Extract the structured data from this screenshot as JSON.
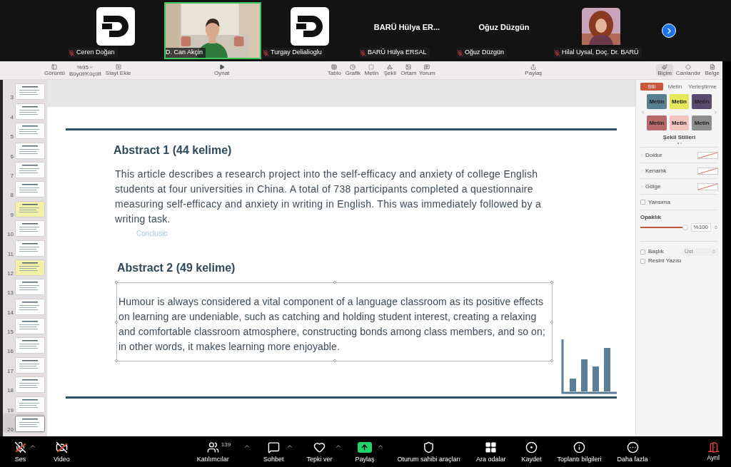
{
  "participants": [
    {
      "name": "Ceren Doğan",
      "kind": "logo",
      "muted": true,
      "active": false
    },
    {
      "name": "D. Can Akçin",
      "kind": "video",
      "muted": false,
      "active": true
    },
    {
      "name": "Turgay Delialioglu",
      "kind": "logo",
      "muted": true,
      "active": false
    },
    {
      "name": "BARÜ Hülya ERSAL",
      "kind": "name",
      "display": "BARÜ Hülya ER...",
      "muted": true,
      "active": false
    },
    {
      "name": "Oğuz Düzgün",
      "kind": "name",
      "display": "Oğuz Düzgün",
      "muted": true,
      "active": false
    },
    {
      "name": "Hilal Uysal, Doç. Dr. BARÜ",
      "muted": true,
      "active": false
    }
  ],
  "toolbar": {
    "left": [
      {
        "label": "Görüntü",
        "kind": "icon"
      },
      {
        "label": "Büyüt/Küçült",
        "kind": "zoom",
        "value": "%95"
      },
      {
        "label": "Slayt Ekle",
        "kind": "icon"
      }
    ],
    "center": {
      "label": "Oynat"
    },
    "insert": [
      "Tablo",
      "Grafik",
      "Metin",
      "Şekil",
      "Ortam",
      "Yorum"
    ],
    "share": "Paylaş",
    "right": [
      {
        "label": "Biçim",
        "selected": true
      },
      {
        "label": "Canlandır",
        "selected": false
      },
      {
        "label": "Belge",
        "selected": false
      }
    ]
  },
  "slides": [
    {
      "number": "3",
      "color": "#ffffff",
      "selected": false
    },
    {
      "number": "4",
      "color": "#ffffff",
      "selected": false
    },
    {
      "number": "5",
      "color": "#ffffff",
      "selected": false
    },
    {
      "number": "6",
      "color": "#ffffff",
      "selected": false
    },
    {
      "number": "7",
      "color": "#ffffff",
      "selected": false
    },
    {
      "number": "8",
      "color": "#ffffff",
      "selected": false
    },
    {
      "number": "9",
      "color": "#f3f0a8",
      "selected": false
    },
    {
      "number": "10",
      "color": "#ffffff",
      "selected": false
    },
    {
      "number": "11",
      "color": "#ffffff",
      "selected": false
    },
    {
      "number": "12",
      "color": "#f3f0a8",
      "selected": false
    },
    {
      "number": "13",
      "color": "#ffffff",
      "selected": false
    },
    {
      "number": "14",
      "color": "#ffffff",
      "selected": false
    },
    {
      "number": "15",
      "color": "#ffffff",
      "selected": false
    },
    {
      "number": "16",
      "color": "#ffffff",
      "selected": false
    },
    {
      "number": "17",
      "color": "#ffffff",
      "selected": false
    },
    {
      "number": "18",
      "color": "#ffffff",
      "selected": false
    },
    {
      "number": "19",
      "color": "#ffffff",
      "selected": false
    },
    {
      "number": "20",
      "color": "#ffffff",
      "selected": true
    }
  ],
  "slide": {
    "heading_1": "Abstract 1 (44 kelime)",
    "text_1": "This article describes a research project into the self-efficacy and anxiety of college English students at four universities in China. A total of 738 participants completed a questionnaire measuring self-efficacy and anxiety in writing in English. This was immediately followed by a writing task.",
    "ghost_text": "Conclusio",
    "heading_2": "Abstract 2 (49 kelime)",
    "text_2": "Humour is always considered a vital component of a language classroom as its positive effects on learning are undeniable, such as catching and holding student interest, creating a relaxing and comfortable classroom atmosphere, constructing bonds among class members, and so on; in other words, it makes learning more enjoyable."
  },
  "inspector": {
    "tabs": [
      {
        "label": "Stil",
        "selected": true
      },
      {
        "label": "Metin",
        "selected": false
      },
      {
        "label": "Yerleştirme",
        "selected": false
      }
    ],
    "styles": [
      {
        "label": "Metin",
        "color": "#5b7f92"
      },
      {
        "label": "Metin",
        "color": "#e4e95a"
      },
      {
        "label": "Metin",
        "color": "#5a4a6e"
      },
      {
        "label": "Metin",
        "color": "#b8696a"
      },
      {
        "label": "Metin",
        "color": "#f3c3c0"
      },
      {
        "label": "Metin",
        "color": "#8e8e8e"
      }
    ],
    "styles_title": "Şekil Stilleri",
    "rows": [
      "Doldur",
      "Kenarlık",
      "Gölge"
    ],
    "reflection": {
      "label": "Yansıma",
      "checked": false
    },
    "opacity": {
      "label": "Opaklık",
      "level": 1,
      "value": "%100"
    },
    "title": {
      "label": "Başlık",
      "checked": false,
      "position": "Üst"
    },
    "caption": {
      "label": "Resim Yazısı",
      "checked": false
    }
  },
  "controls": [
    {
      "label": "Ses",
      "kind": "mic",
      "off": true,
      "caret": true
    },
    {
      "label": "Video",
      "kind": "video",
      "off": true,
      "caret": false
    }
  ],
  "meeting": [
    {
      "label": "Katılımcılar",
      "kind": "users",
      "count": "139",
      "caret": true
    },
    {
      "label": "Sohbet",
      "kind": "chat",
      "caret": true
    },
    {
      "label": "Tepki ver",
      "kind": "heart",
      "caret": true
    },
    {
      "label": "Paylaş",
      "kind": "share",
      "caret": true
    },
    {
      "label": "Oturum sahibi araçları",
      "kind": "shield",
      "caret": false
    },
    {
      "label": "Ara odalar",
      "kind": "grid",
      "caret": false
    },
    {
      "label": "Kaydet",
      "kind": "record",
      "caret": false
    },
    {
      "label": "Toplantı bilgileri",
      "kind": "info",
      "caret": false
    },
    {
      "label": "Daha fazla",
      "kind": "more",
      "caret": false
    }
  ],
  "leave": "Ayrıl"
}
